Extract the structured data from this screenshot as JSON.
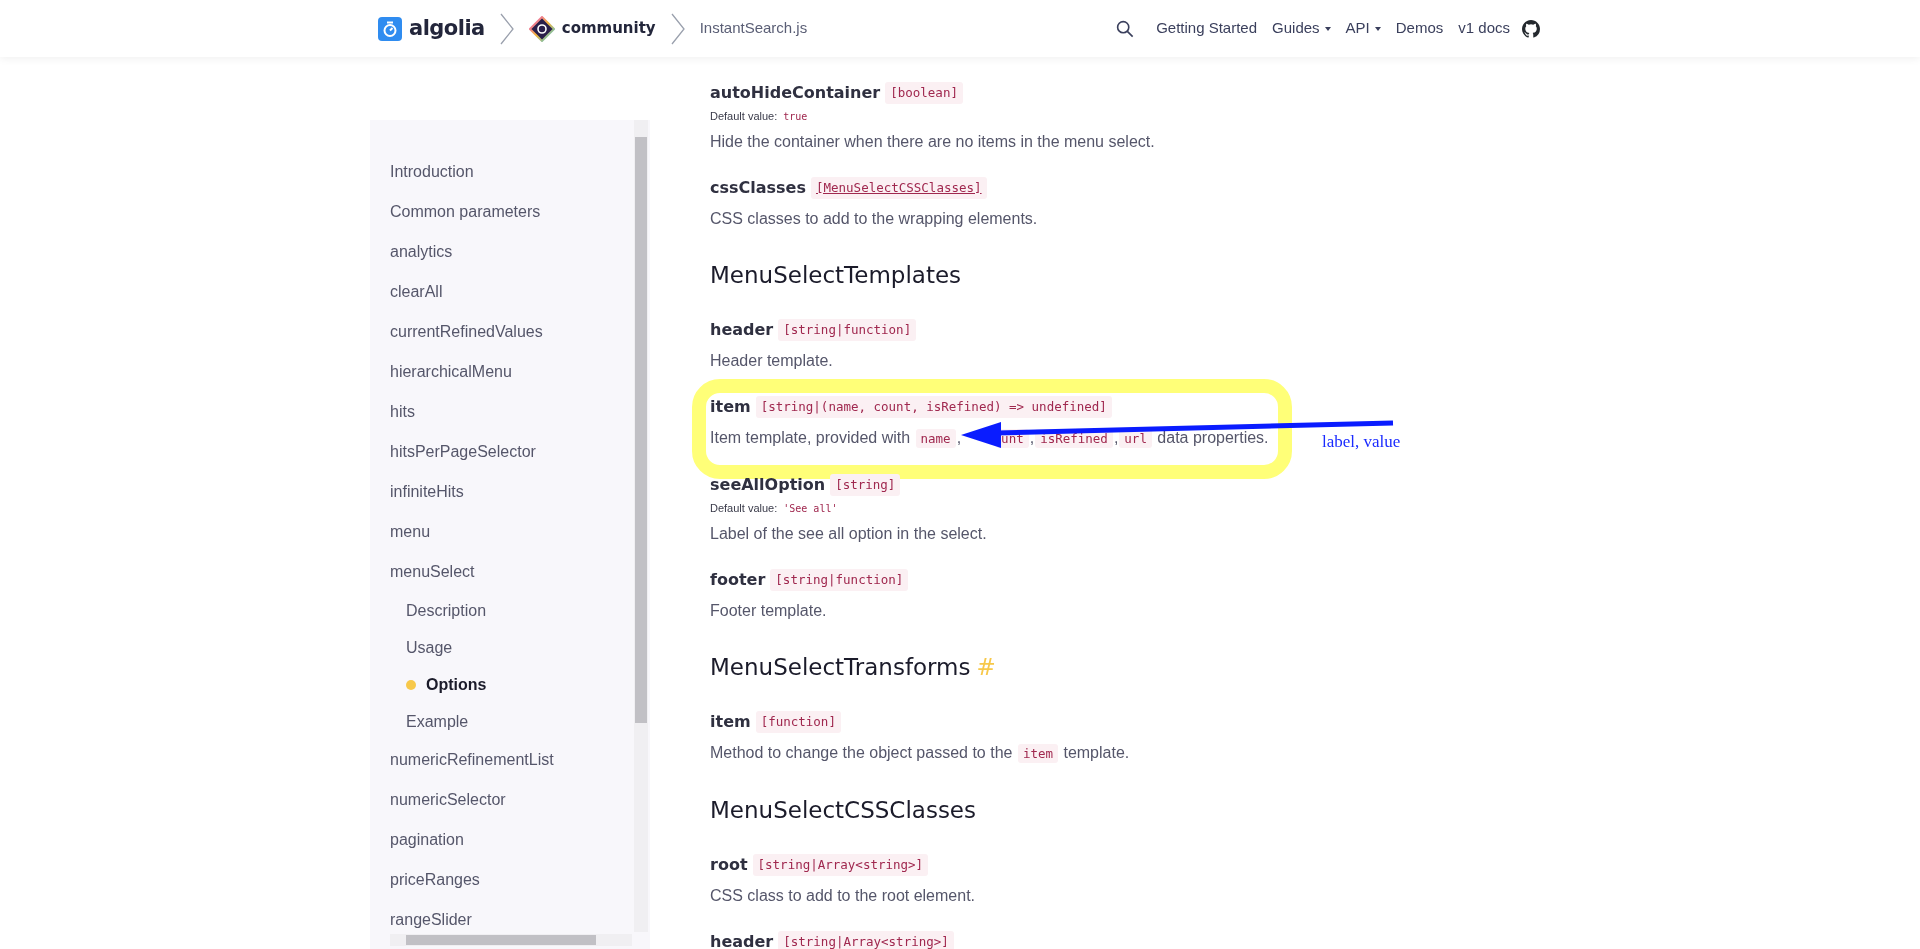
{
  "header": {
    "breadcrumbs": [
      {
        "kind": "algolia",
        "label": "algolia"
      },
      {
        "kind": "community",
        "label": "community"
      },
      {
        "kind": "plain",
        "label": "InstantSearch.js"
      }
    ],
    "nav": [
      {
        "label": "Getting Started",
        "has_menu": false
      },
      {
        "label": "Guides",
        "has_menu": true
      },
      {
        "label": "API",
        "has_menu": true
      },
      {
        "label": "Demos",
        "has_menu": false
      },
      {
        "label": "v1 docs",
        "has_menu": false
      }
    ]
  },
  "sidebar": {
    "items": [
      {
        "label": "Introduction",
        "selected": false
      },
      {
        "label": "Common parameters",
        "selected": false
      },
      {
        "label": "analytics",
        "selected": false
      },
      {
        "label": "clearAll",
        "selected": false
      },
      {
        "label": "currentRefinedValues",
        "selected": false
      },
      {
        "label": "hierarchicalMenu",
        "selected": false
      },
      {
        "label": "hits",
        "selected": false
      },
      {
        "label": "hitsPerPageSelector",
        "selected": false
      },
      {
        "label": "infiniteHits",
        "selected": false
      },
      {
        "label": "menu",
        "selected": false
      },
      {
        "label": "menuSelect",
        "selected": false,
        "children": [
          {
            "label": "Description",
            "selected": false
          },
          {
            "label": "Usage",
            "selected": false
          },
          {
            "label": "Options",
            "selected": true
          },
          {
            "label": "Example",
            "selected": false
          }
        ]
      },
      {
        "label": "numericRefinementList",
        "selected": false
      },
      {
        "label": "numericSelector",
        "selected": false
      },
      {
        "label": "pagination",
        "selected": false
      },
      {
        "label": "priceRanges",
        "selected": false
      },
      {
        "label": "rangeSlider",
        "selected": false
      }
    ]
  },
  "content": [
    {
      "kind": "param",
      "name": "autoHideContainer",
      "type": "[boolean]",
      "default_label": "Default value:",
      "default": "true",
      "description": [
        {
          "kind": "text",
          "text": "Hide the container when there are no items in the menu select."
        }
      ]
    },
    {
      "kind": "param",
      "name": "cssClasses",
      "type": "[MenuSelectCSSClasses]",
      "type_link": true,
      "description": [
        {
          "kind": "text",
          "text": "CSS classes to add to the wrapping elements."
        }
      ]
    },
    {
      "kind": "heading",
      "text": "MenuSelectTemplates"
    },
    {
      "kind": "param",
      "name": "header",
      "type": "[string|function]",
      "description": [
        {
          "kind": "text",
          "text": "Header template."
        }
      ]
    },
    {
      "kind": "param",
      "name": "item",
      "type": "[string|(name, count, isRefined) => undefined]",
      "highlighted": true,
      "annotation": "label, value",
      "description": [
        {
          "kind": "text",
          "text": "Item template, provided with "
        },
        {
          "kind": "code",
          "text": "name"
        },
        {
          "kind": "text",
          "text": ","
        },
        {
          "kind": "arrow"
        },
        {
          "kind": "code",
          "text": "unt"
        },
        {
          "kind": "text",
          "text": ","
        },
        {
          "kind": "code",
          "text": "isRefined"
        },
        {
          "kind": "text",
          "text": ","
        },
        {
          "kind": "code",
          "text": "url"
        },
        {
          "kind": "text",
          "text": " data properties."
        }
      ]
    },
    {
      "kind": "param",
      "name": "seeAllOption",
      "type": "[string]",
      "default_label": "Default value:",
      "default": "'See all'",
      "description": [
        {
          "kind": "text",
          "text": "Label of the see all option in the select."
        }
      ]
    },
    {
      "kind": "param",
      "name": "footer",
      "type": "[string|function]",
      "description": [
        {
          "kind": "text",
          "text": "Footer template."
        }
      ]
    },
    {
      "kind": "heading",
      "text": "MenuSelectTransforms",
      "anchor": "#"
    },
    {
      "kind": "param",
      "name": "item",
      "type": "[function]",
      "description": [
        {
          "kind": "text",
          "text": "Method to change the object passed to the "
        },
        {
          "kind": "code",
          "text": "item"
        },
        {
          "kind": "text",
          "text": " template."
        }
      ]
    },
    {
      "kind": "heading",
      "text": "MenuSelectCSSClasses"
    },
    {
      "kind": "param",
      "name": "root",
      "type": "[string|Array<string>]",
      "description": [
        {
          "kind": "text",
          "text": "CSS class to add to the root element."
        }
      ]
    },
    {
      "kind": "param",
      "name": "header",
      "type": "[string|Array<string>]"
    }
  ]
}
